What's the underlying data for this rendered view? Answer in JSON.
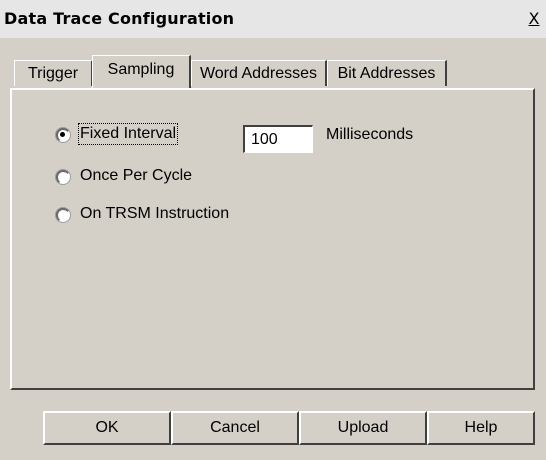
{
  "window": {
    "title": "Data Trace Configuration",
    "close_label": "X"
  },
  "tabs": [
    {
      "label": "Trigger",
      "active": false
    },
    {
      "label": "Sampling",
      "active": true
    },
    {
      "label": "Word Addresses",
      "active": false
    },
    {
      "label": "Bit Addresses",
      "active": false
    }
  ],
  "sampling": {
    "options": [
      {
        "label": "Fixed Interval",
        "selected": true
      },
      {
        "label": "Once Per Cycle",
        "selected": false
      },
      {
        "label": "On TRSM Instruction",
        "selected": false
      }
    ],
    "interval_value": "100",
    "interval_unit": "Milliseconds"
  },
  "buttons": {
    "ok": "OK",
    "cancel": "Cancel",
    "upload": "Upload",
    "help": "Help"
  }
}
